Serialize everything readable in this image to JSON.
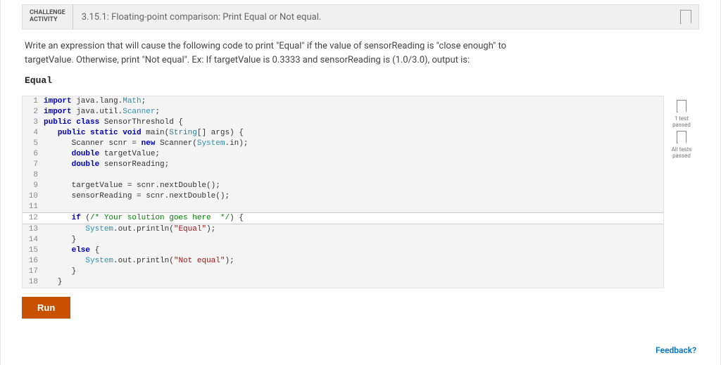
{
  "header": {
    "badge_l1": "CHALLENGE",
    "badge_l2": "ACTIVITY",
    "title": "3.15.1: Floating-point comparison: Print Equal or Not equal."
  },
  "prompt": {
    "line1": "Write an expression that will cause the following code to print \"Equal\" if the value of sensorReading is \"close enough\" to",
    "line2": "targetValue. Otherwise, print \"Not equal\". Ex: If targetValue is 0.3333 and sensorReading is (1.0/3.0), output is:",
    "expected_output": "Equal"
  },
  "code": {
    "highlight_line": 12,
    "lines": [
      {
        "n": 1,
        "tokens": [
          {
            "t": "import",
            "c": "kw"
          },
          {
            "t": " java.lang."
          },
          {
            "t": "Math",
            "c": "cls"
          },
          {
            "t": ";"
          }
        ]
      },
      {
        "n": 2,
        "tokens": [
          {
            "t": "import",
            "c": "kw"
          },
          {
            "t": " java.util."
          },
          {
            "t": "Scanner",
            "c": "cls"
          },
          {
            "t": ";"
          }
        ]
      },
      {
        "n": 3,
        "tokens": [
          {
            "t": "public class",
            "c": "kw"
          },
          {
            "t": " SensorThreshold {"
          }
        ]
      },
      {
        "n": 4,
        "tokens": [
          {
            "t": "   "
          },
          {
            "t": "public static void",
            "c": "kw"
          },
          {
            "t": " main("
          },
          {
            "t": "String",
            "c": "typ"
          },
          {
            "t": "[] args) {"
          }
        ]
      },
      {
        "n": 5,
        "tokens": [
          {
            "t": "      Scanner scnr = "
          },
          {
            "t": "new",
            "c": "kw"
          },
          {
            "t": " Scanner("
          },
          {
            "t": "System",
            "c": "cls"
          },
          {
            "t": ".in);"
          }
        ]
      },
      {
        "n": 6,
        "tokens": [
          {
            "t": "      "
          },
          {
            "t": "double",
            "c": "kw"
          },
          {
            "t": " targetValue;"
          }
        ]
      },
      {
        "n": 7,
        "tokens": [
          {
            "t": "      "
          },
          {
            "t": "double",
            "c": "kw"
          },
          {
            "t": " sensorReading;"
          }
        ]
      },
      {
        "n": 8,
        "tokens": [
          {
            "t": " "
          }
        ]
      },
      {
        "n": 9,
        "tokens": [
          {
            "t": "      targetValue = scnr.nextDouble();"
          }
        ]
      },
      {
        "n": 10,
        "tokens": [
          {
            "t": "      sensorReading = scnr.nextDouble();"
          }
        ]
      },
      {
        "n": 11,
        "tokens": [
          {
            "t": " "
          }
        ]
      },
      {
        "n": 12,
        "tokens": [
          {
            "t": "      "
          },
          {
            "t": "if",
            "c": "kw"
          },
          {
            "t": " ("
          },
          {
            "t": "/* Your solution goes here  */",
            "c": "cmt"
          },
          {
            "t": ") {"
          }
        ]
      },
      {
        "n": 13,
        "tokens": [
          {
            "t": "         "
          },
          {
            "t": "System",
            "c": "cls"
          },
          {
            "t": ".out.println("
          },
          {
            "t": "\"Equal\"",
            "c": "str"
          },
          {
            "t": ");"
          }
        ]
      },
      {
        "n": 14,
        "tokens": [
          {
            "t": "      }"
          }
        ]
      },
      {
        "n": 15,
        "tokens": [
          {
            "t": "      "
          },
          {
            "t": "else",
            "c": "kw"
          },
          {
            "t": " {"
          }
        ]
      },
      {
        "n": 16,
        "tokens": [
          {
            "t": "         "
          },
          {
            "t": "System",
            "c": "cls"
          },
          {
            "t": ".out.println("
          },
          {
            "t": "\"Not equal\"",
            "c": "str"
          },
          {
            "t": ");"
          }
        ]
      },
      {
        "n": 17,
        "tokens": [
          {
            "t": "      }"
          }
        ]
      },
      {
        "n": 18,
        "tokens": [
          {
            "t": "   }"
          }
        ]
      }
    ]
  },
  "sidebar": {
    "status1": "1 test\npassed",
    "status2": "All tests\npassed"
  },
  "actions": {
    "run_label": "Run",
    "feedback_label": "Feedback?"
  }
}
